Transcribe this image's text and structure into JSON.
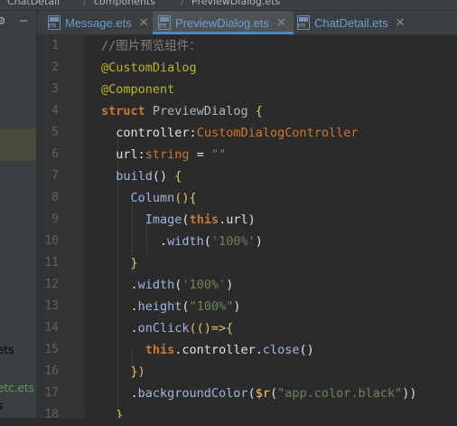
{
  "breadcrumb": [
    "ChatDetail",
    "components",
    "PreviewDialog.ets"
  ],
  "left_panel": {
    "items": [
      {
        "label": "ets",
        "color": "#a9b7c6"
      },
      {
        "label": "etc.ets",
        "color": "#629755"
      },
      {
        "label": "s",
        "color": "#a9b7c6"
      }
    ]
  },
  "tabs": [
    {
      "label": "Message.ets",
      "active": false,
      "color": "#6a9dd6"
    },
    {
      "label": "PreviewDialog.ets",
      "active": true,
      "color": "#6a9dd6"
    },
    {
      "label": "ChatDetail.ets",
      "active": false,
      "color": "#6a9dd6"
    }
  ],
  "line_numbers": [
    "1",
    "2",
    "3",
    "4",
    "5",
    "6",
    "7",
    "8",
    "9",
    "10",
    "11",
    "12",
    "13",
    "14",
    "15",
    "16",
    "17",
    "18"
  ],
  "code": [
    [
      {
        "t": "//图片预览组件：",
        "c": "comment"
      }
    ],
    [
      {
        "t": "@CustomDialog",
        "c": "anno"
      }
    ],
    [
      {
        "t": "@Component",
        "c": "anno"
      }
    ],
    [
      {
        "t": "struct",
        "c": "kwb"
      },
      {
        "t": " PreviewDialog ",
        "c": "struct"
      },
      {
        "t": "{",
        "c": "brace"
      }
    ],
    [
      {
        "t": "  controller",
        "c": "plain"
      },
      {
        "t": ":",
        "c": "plain"
      },
      {
        "t": "CustomDialogController",
        "c": "kw"
      }
    ],
    [
      {
        "t": "  url",
        "c": "plain"
      },
      {
        "t": ":",
        "c": "plain"
      },
      {
        "t": "string",
        "c": "kw"
      },
      {
        "t": " = ",
        "c": "plain"
      },
      {
        "t": "\"\"",
        "c": "str"
      }
    ],
    [
      {
        "t": "  ",
        "c": "plain"
      },
      {
        "t": "build",
        "c": "method"
      },
      {
        "t": "() ",
        "c": "plain"
      },
      {
        "t": "{",
        "c": "brace"
      }
    ],
    [
      {
        "t": "    ",
        "c": "plain"
      },
      {
        "t": "Column",
        "c": "method"
      },
      {
        "t": "(){",
        "c": "brace"
      }
    ],
    [
      {
        "t": "      ",
        "c": "plain"
      },
      {
        "t": "Image",
        "c": "method"
      },
      {
        "t": "(",
        "c": "plain"
      },
      {
        "t": "this",
        "c": "this"
      },
      {
        "t": ".url)",
        "c": "plain"
      }
    ],
    [
      {
        "t": "        .",
        "c": "plain"
      },
      {
        "t": "width",
        "c": "method"
      },
      {
        "t": "(",
        "c": "plain"
      },
      {
        "t": "'100%'",
        "c": "str"
      },
      {
        "t": ")",
        "c": "plain"
      }
    ],
    [
      {
        "t": "    }",
        "c": "brace"
      }
    ],
    [
      {
        "t": "    .",
        "c": "plain"
      },
      {
        "t": "width",
        "c": "method"
      },
      {
        "t": "(",
        "c": "plain"
      },
      {
        "t": "'100%'",
        "c": "str"
      },
      {
        "t": ")",
        "c": "plain"
      }
    ],
    [
      {
        "t": "    .",
        "c": "plain"
      },
      {
        "t": "height",
        "c": "method"
      },
      {
        "t": "(",
        "c": "plain"
      },
      {
        "t": "\"100%\"",
        "c": "str"
      },
      {
        "t": ")",
        "c": "plain"
      }
    ],
    [
      {
        "t": "    .",
        "c": "plain"
      },
      {
        "t": "onClick",
        "c": "method"
      },
      {
        "t": "(()=>{",
        "c": "brace"
      }
    ],
    [
      {
        "t": "      ",
        "c": "plain"
      },
      {
        "t": "this",
        "c": "this"
      },
      {
        "t": ".controller.",
        "c": "plain"
      },
      {
        "t": "close",
        "c": "method"
      },
      {
        "t": "()",
        "c": "plain"
      }
    ],
    [
      {
        "t": "    })",
        "c": "brace"
      }
    ],
    [
      {
        "t": "    .",
        "c": "plain"
      },
      {
        "t": "backgroundColor",
        "c": "method"
      },
      {
        "t": "(",
        "c": "plain"
      },
      {
        "t": "$r",
        "c": "func"
      },
      {
        "t": "(",
        "c": "plain"
      },
      {
        "t": "\"app.color.black\"",
        "c": "str"
      },
      {
        "t": "))",
        "c": "plain"
      }
    ],
    [
      {
        "t": "  }",
        "c": "brace"
      }
    ]
  ]
}
